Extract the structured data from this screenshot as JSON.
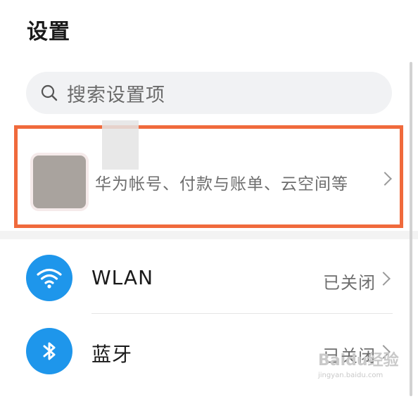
{
  "page": {
    "title": "设置"
  },
  "search": {
    "placeholder": "搜索设置项",
    "icon": "search-icon"
  },
  "account": {
    "description": "华为帐号、付款与账单、云空间等",
    "highlight_color": "#f06a3c"
  },
  "settings": [
    {
      "label": "WLAN",
      "status": "已关闭",
      "icon": "wifi-icon"
    },
    {
      "label": "蓝牙",
      "status": "已关闭",
      "icon": "bluetooth-icon"
    }
  ],
  "colors": {
    "icon_bg": "#1e96eb"
  },
  "watermark": {
    "brand": "Baidu经验",
    "sub": "jingyan.baidu.com"
  }
}
